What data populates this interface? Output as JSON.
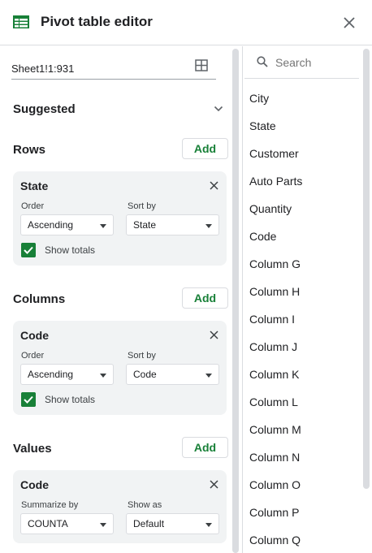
{
  "header": {
    "title": "Pivot table editor"
  },
  "range": "Sheet1!1:931",
  "suggested": {
    "label": "Suggested"
  },
  "rows": {
    "label": "Rows",
    "add_label": "Add",
    "card": {
      "title": "State",
      "order_label": "Order",
      "order_value": "Ascending",
      "sortby_label": "Sort by",
      "sortby_value": "State",
      "show_totals_label": "Show totals"
    }
  },
  "columns": {
    "label": "Columns",
    "add_label": "Add",
    "card": {
      "title": "Code",
      "order_label": "Order",
      "order_value": "Ascending",
      "sortby_label": "Sort by",
      "sortby_value": "Code",
      "show_totals_label": "Show totals"
    }
  },
  "values": {
    "label": "Values",
    "add_label": "Add",
    "card": {
      "title": "Code",
      "summarize_label": "Summarize by",
      "summarize_value": "COUNTA",
      "showas_label": "Show as",
      "showas_value": "Default"
    }
  },
  "fields": {
    "search_placeholder": "Search",
    "items": [
      "City",
      "State",
      "Customer",
      "Auto Parts",
      "Quantity",
      "Code",
      "Column G",
      "Column H",
      "Column I",
      "Column J",
      "Column K",
      "Column L",
      "Column M",
      "Column N",
      "Column O",
      "Column P",
      "Column Q"
    ]
  },
  "colors": {
    "accent": "#188038",
    "card_bg": "#f1f3f4",
    "border": "#dadce0"
  }
}
